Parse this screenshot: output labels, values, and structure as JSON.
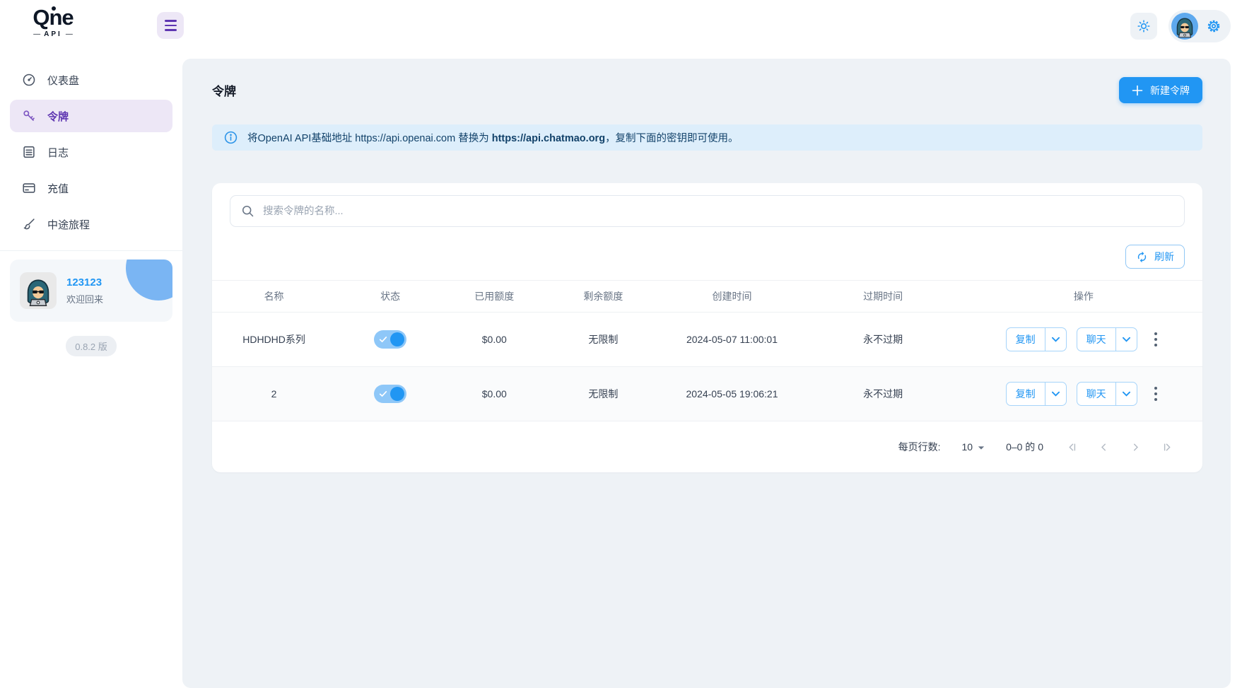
{
  "brand": {
    "name": "Qne",
    "sub": "API"
  },
  "topbar": {
    "icons": [
      "theme-sun-icon",
      "user-avatar",
      "settings-gear-icon"
    ]
  },
  "sidebar": {
    "items": [
      {
        "label": "仪表盘",
        "icon": "gauge-icon",
        "active": false
      },
      {
        "label": "令牌",
        "icon": "key-icon",
        "active": true
      },
      {
        "label": "日志",
        "icon": "log-icon",
        "active": false
      },
      {
        "label": "充值",
        "icon": "card-icon",
        "active": false
      },
      {
        "label": "中途旅程",
        "icon": "brush-icon",
        "active": false
      }
    ],
    "user": {
      "name": "123123",
      "greeting": "欢迎回来"
    },
    "version": "0.8.2 版"
  },
  "page": {
    "title": "令牌",
    "new_token": "新建令牌"
  },
  "notice": {
    "prefix": "将OpenAI API基础地址 https://api.openai.com 替换为 ",
    "highlight": "https://api.chatmao.org",
    "suffix": "，复制下面的密钥即可使用。"
  },
  "toolbar": {
    "search_placeholder": "搜索令牌的名称...",
    "refresh": "刷新"
  },
  "table": {
    "headers": [
      "名称",
      "状态",
      "已用额度",
      "剩余额度",
      "创建时间",
      "过期时间",
      "操作"
    ],
    "rows": [
      {
        "name": "HDHDHD系列",
        "enabled": true,
        "used": "$0.00",
        "remaining": "无限制",
        "created": "2024-05-07 11:00:01",
        "expires": "永不过期",
        "actions": {
          "copy": "复制",
          "chat": "聊天"
        }
      },
      {
        "name": "2",
        "enabled": true,
        "used": "$0.00",
        "remaining": "无限制",
        "created": "2024-05-05 19:06:21",
        "expires": "永不过期",
        "actions": {
          "copy": "复制",
          "chat": "聊天"
        }
      }
    ]
  },
  "pagination": {
    "label": "每页行数:",
    "per_page": "10",
    "range": "0–0 的 0"
  },
  "colors": {
    "accent": "#2196f3",
    "purple": "#5e35b1",
    "panel_bg": "#eef2f6",
    "banner_bg": "#ddeefb",
    "toggle_track": "#8ec7f8"
  }
}
